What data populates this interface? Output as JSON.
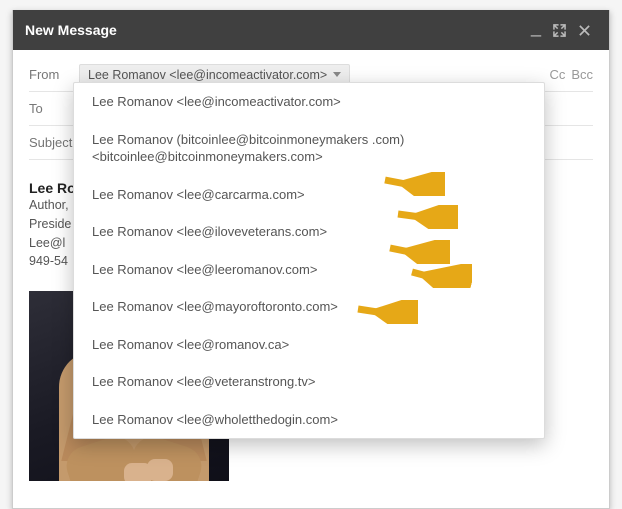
{
  "window": {
    "title": "New Message"
  },
  "header": {
    "from_label": "From",
    "to_label": "To",
    "subject_placeholder": "Subject",
    "cc_label": "Cc",
    "bcc_label": "Bcc",
    "from_selected": "Lee Romanov <lee@incomeactivator.com>"
  },
  "dropdown_items": [
    "Lee Romanov <lee@incomeactivator.com>",
    "Lee Romanov (bitcoinlee@bitcoinmoneymakers .com) <bitcoinlee@bitcoinmoneymakers.com>",
    "Lee Romanov <lee@carcarma.com>",
    "Lee Romanov <lee@iloveveterans.com>",
    "Lee Romanov <lee@leeromanov.com>",
    "Lee Romanov <lee@mayoroftoronto.com>",
    "Lee Romanov <lee@romanov.ca>",
    "Lee Romanov <lee@veteranstrong.tv>",
    "Lee Romanov <lee@wholetthedogin.com>"
  ],
  "signature": {
    "name": "Lee Romanov",
    "line1": "Author,",
    "line2": "Preside",
    "line3": "Lee@l",
    "line4": "949-54"
  }
}
